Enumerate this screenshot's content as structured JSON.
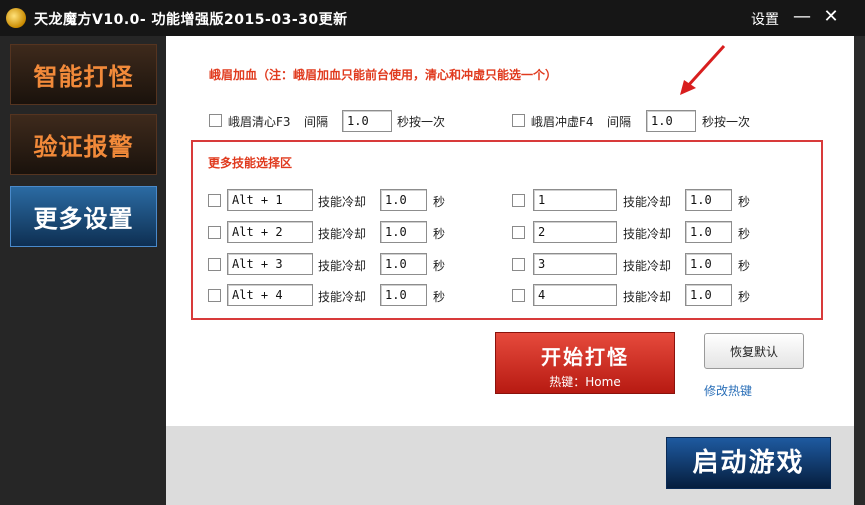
{
  "window": {
    "title": "天龙魔方V10.0- 功能增强版2015-03-30更新",
    "settings_label": "设置",
    "minimize_glyph": "—",
    "close_glyph": "✕"
  },
  "sidebar": {
    "items": [
      {
        "label": "智能打怪",
        "active": false
      },
      {
        "label": "验证报警",
        "active": false
      },
      {
        "label": "更多设置",
        "active": true
      }
    ]
  },
  "heal": {
    "title": "峨眉加血（注：峨眉加血只能前台使用，清心和冲虚只能选一个）",
    "row": [
      {
        "label": "峨眉清心F3",
        "interval_label": "间隔",
        "value": "1.0",
        "suffix": "秒按一次",
        "checked": false
      },
      {
        "label": "峨眉冲虚F4",
        "interval_label": "间隔",
        "value": "1.0",
        "suffix": "秒按一次",
        "checked": false
      }
    ]
  },
  "skills": {
    "title": "更多技能选择区",
    "cooldown_label": "技能冷却",
    "unit": "秒",
    "left": [
      {
        "key": "Alt + 1",
        "cooldown": "1.0",
        "checked": false
      },
      {
        "key": "Alt + 2",
        "cooldown": "1.0",
        "checked": false
      },
      {
        "key": "Alt + 3",
        "cooldown": "1.0",
        "checked": false
      },
      {
        "key": "Alt + 4",
        "cooldown": "1.0",
        "checked": false
      }
    ],
    "right": [
      {
        "key": "1",
        "cooldown": "1.0",
        "checked": false
      },
      {
        "key": "2",
        "cooldown": "1.0",
        "checked": false
      },
      {
        "key": "3",
        "cooldown": "1.0",
        "checked": false
      },
      {
        "key": "4",
        "cooldown": "1.0",
        "checked": false
      }
    ]
  },
  "actions": {
    "start_label": "开始打怪",
    "start_hotkey": "热键：Home",
    "reset_label": "恢复默认",
    "modify_hotkey_label": "修改热键",
    "launch_label": "启动游戏"
  },
  "colors": {
    "accent_red": "#e03a1e",
    "box_red": "#d83a3a",
    "link_blue": "#2a6fb8",
    "nav_orange": "#f28a3a",
    "nav_active_blue": "#2b6ba3"
  }
}
